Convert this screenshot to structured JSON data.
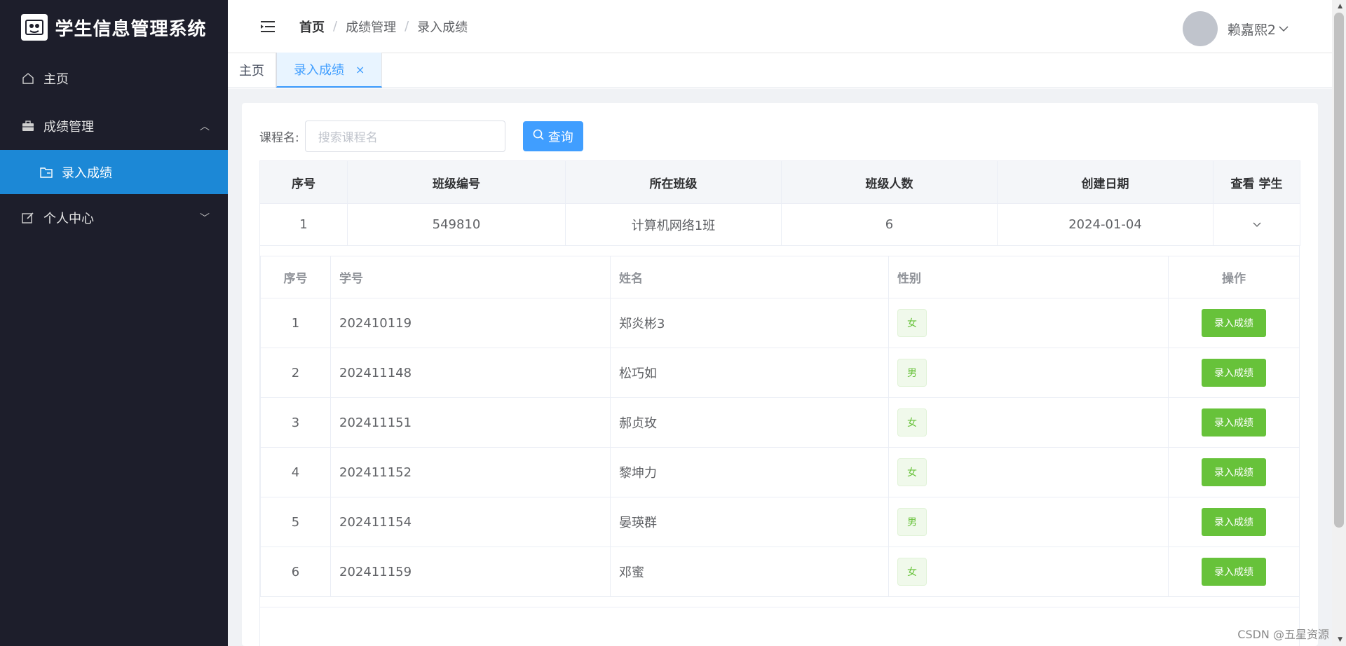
{
  "app": {
    "title": "学生信息管理系统"
  },
  "sidebar": {
    "items": [
      {
        "label": "主页",
        "icon": "home-icon"
      },
      {
        "label": "成绩管理",
        "icon": "briefcase-icon",
        "expanded": true
      },
      {
        "label": "录入成绩",
        "icon": "folder-icon",
        "active": true
      },
      {
        "label": "个人中心",
        "icon": "edit-icon",
        "expanded": false
      }
    ]
  },
  "header": {
    "breadcrumb": [
      "首页",
      "成绩管理",
      "录入成绩"
    ],
    "username": "赖嘉熙2"
  },
  "tabs": [
    {
      "label": "主页"
    },
    {
      "label": "录入成绩",
      "active": true,
      "close": "×"
    }
  ],
  "search": {
    "label": "课程名:",
    "placeholder": "搜索课程名",
    "button": "查询"
  },
  "class_table": {
    "headers": [
      "序号",
      "班级编号",
      "所在班级",
      "班级人数",
      "创建日期",
      "查看 学生"
    ],
    "rows": [
      {
        "index": "1",
        "class_id": "549810",
        "class_name": "计算机网络1班",
        "count": "6",
        "created": "2024-01-04"
      }
    ]
  },
  "student_table": {
    "headers": [
      "序号",
      "学号",
      "姓名",
      "性别",
      "操作"
    ],
    "action_label": "录入成绩",
    "rows": [
      {
        "index": "1",
        "student_id": "202410119",
        "name": "郑炎彬3",
        "gender": "女"
      },
      {
        "index": "2",
        "student_id": "202411148",
        "name": "松巧如",
        "gender": "男"
      },
      {
        "index": "3",
        "student_id": "202411151",
        "name": "郝贞玫",
        "gender": "女"
      },
      {
        "index": "4",
        "student_id": "202411152",
        "name": "黎坤力",
        "gender": "女"
      },
      {
        "index": "5",
        "student_id": "202411154",
        "name": "晏瑛群",
        "gender": "男"
      },
      {
        "index": "6",
        "student_id": "202411159",
        "name": "邓蜜",
        "gender": "女"
      }
    ]
  },
  "watermark": "CSDN @五星资源",
  "colors": {
    "sidebar_bg": "#1d1e2b",
    "sidebar_active": "#1c88d6",
    "primary": "#409eff",
    "success": "#67c23a"
  }
}
